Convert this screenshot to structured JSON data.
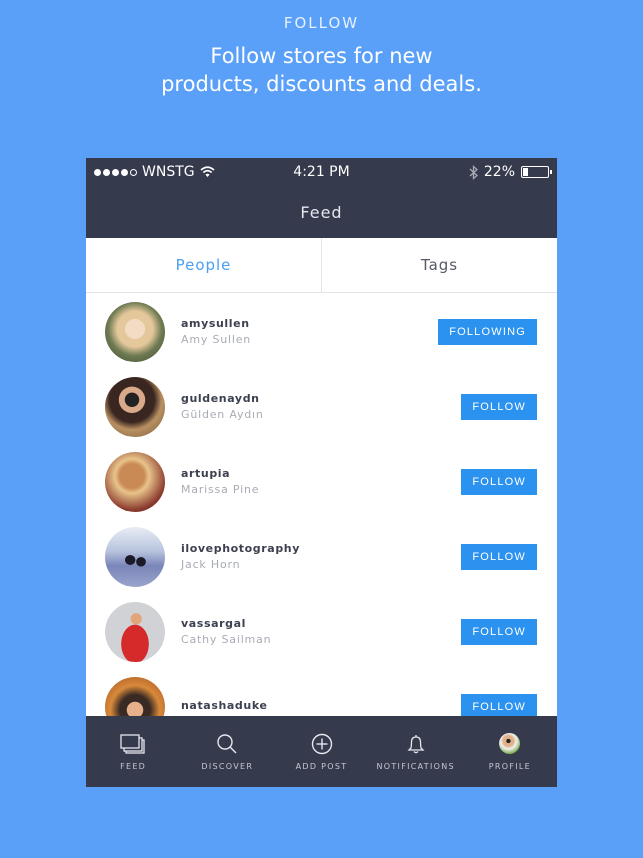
{
  "promo": {
    "kicker": "FOLLOW",
    "headline": "Follow stores for new products, discounts and deals."
  },
  "statusbar": {
    "carrier": "WNSTG",
    "signal_bars": 4,
    "signal_max": 5,
    "time": "4:21 PM",
    "battery": "22%",
    "battery_level": 0.22,
    "icons": [
      "signal-dots-icon",
      "wifi-icon",
      "bluetooth-icon",
      "battery-icon"
    ]
  },
  "navbar": {
    "title": "Feed"
  },
  "tabs": [
    {
      "label": "People",
      "active": true
    },
    {
      "label": "Tags",
      "active": false
    }
  ],
  "people": [
    {
      "username": "amysullen",
      "name": "Amy Sullen",
      "button": "FOLLOWING",
      "following": true
    },
    {
      "username": "guldenaydn",
      "name": "Gülden Aydın",
      "button": "FOLLOW",
      "following": false
    },
    {
      "username": "artupia",
      "name": "Marissa Pine",
      "button": "FOLLOW",
      "following": false
    },
    {
      "username": "ilovephotography",
      "name": "Jack Horn",
      "button": "FOLLOW",
      "following": false
    },
    {
      "username": "vassargal",
      "name": "Cathy Sailman",
      "button": "FOLLOW",
      "following": false
    },
    {
      "username": "natashaduke",
      "name": "",
      "button": "FOLLOW",
      "following": false
    }
  ],
  "tabbar": [
    {
      "label": "FEED",
      "icon": "feed-icon"
    },
    {
      "label": "DISCOVER",
      "icon": "search-icon"
    },
    {
      "label": "ADD POST",
      "icon": "add-circle-icon"
    },
    {
      "label": "NOTIFICATIONS",
      "icon": "bell-icon"
    },
    {
      "label": "PROFILE",
      "icon": "profile-avatar-icon"
    }
  ],
  "colors": {
    "background": "#5aa0f8",
    "bar": "#363a4d",
    "accent": "#2b92f0",
    "active_tab": "#4a9ff2"
  }
}
